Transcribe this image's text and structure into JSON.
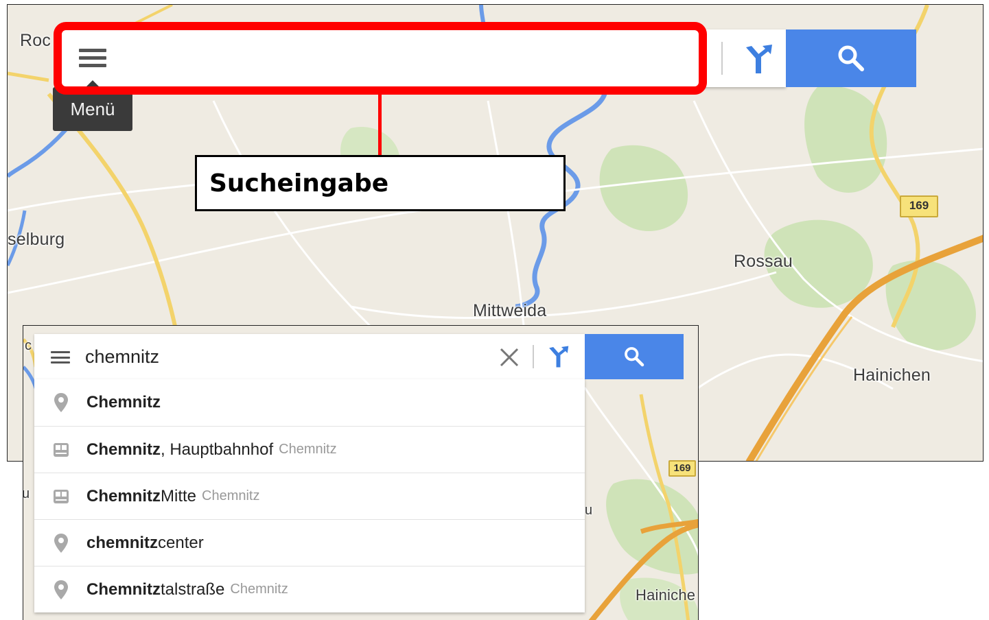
{
  "top_map": {
    "places": [
      "Roc",
      "selburg",
      "Rossau",
      "Mittweida",
      "Hainichen"
    ],
    "road_number": "169",
    "tooltip": "Menü",
    "callout_label": "Sucheingabe",
    "icons": [
      "menu-icon",
      "directions-icon",
      "search-icon"
    ]
  },
  "bottom_map": {
    "places": [
      "Hainiche",
      "u",
      "u",
      "c"
    ],
    "road_number": "169",
    "search": {
      "query": "chemnitz"
    },
    "suggestions": [
      {
        "bold": "Chemnitz",
        "rest": "",
        "context": "",
        "icon": "place-pin-icon"
      },
      {
        "bold": "Chemnitz",
        "rest": ", Hauptbahnhof",
        "context": "Chemnitz",
        "icon": "train-station-icon"
      },
      {
        "bold": "Chemnitz",
        "rest": " Mitte",
        "context": "Chemnitz",
        "icon": "train-station-icon"
      },
      {
        "bold": "chemnitz",
        "rest": " center",
        "context": "",
        "icon": "place-pin-icon"
      },
      {
        "bold": "Chemnitz",
        "rest": "talstraße",
        "context": "Chemnitz",
        "icon": "place-pin-icon"
      }
    ]
  },
  "colors": {
    "highlight": "#ff0000",
    "search_button": "#4a86e8",
    "map_background": "#efebe2",
    "motorway": "#e8a23a",
    "water": "#6b9be8",
    "forest": "#cfe3b8"
  }
}
